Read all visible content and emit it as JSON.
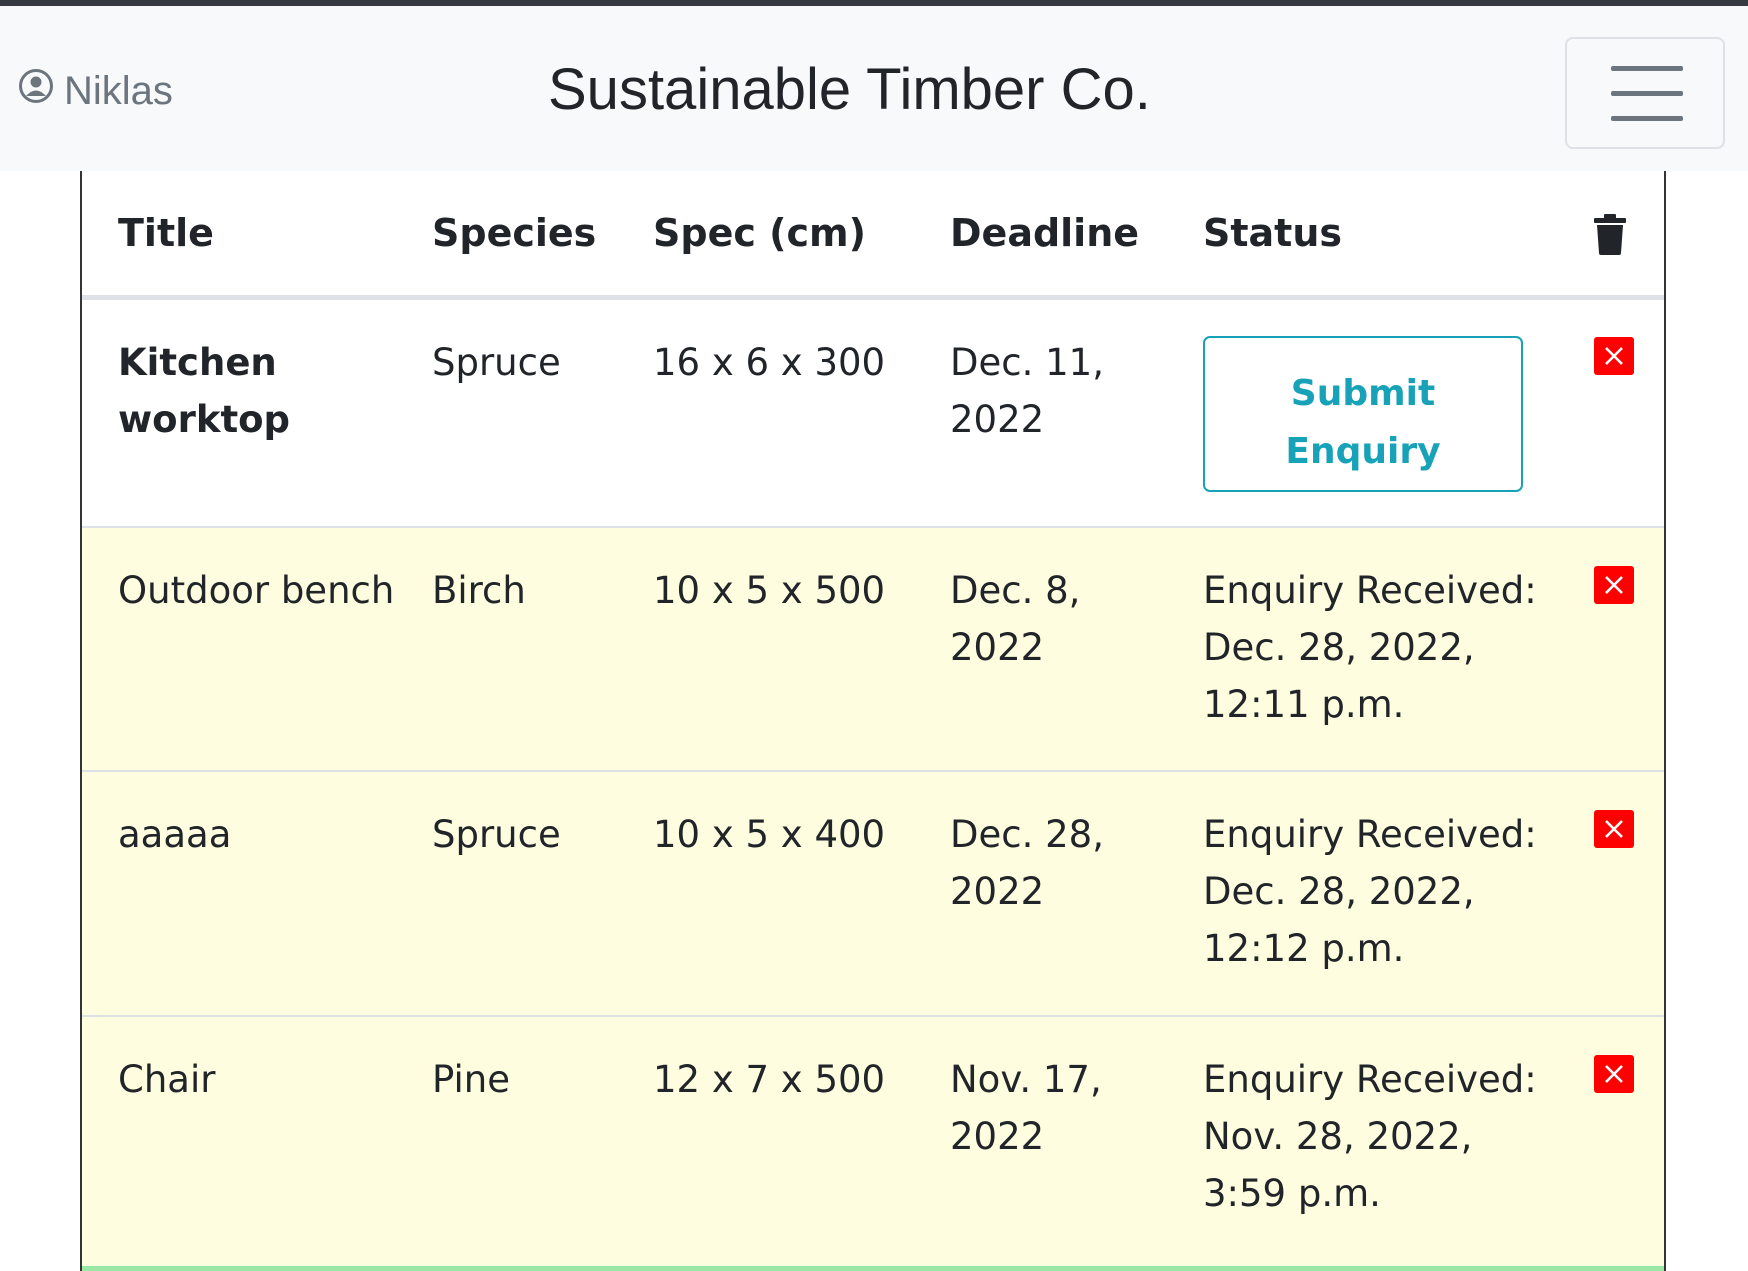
{
  "navbar": {
    "user_name": "Niklas",
    "brand": "Sustainable Timber Co."
  },
  "table": {
    "headers": {
      "title": "Title",
      "species": "Species",
      "spec": "Spec (cm)",
      "deadline": "Deadline",
      "status": "Status"
    },
    "rows": [
      {
        "title": "Kitchen worktop",
        "species": "Spruce",
        "spec": "16 x 6 x 300",
        "deadline": "Dec. 11, 2022",
        "status": "",
        "action_label": "Submit Enquiry"
      },
      {
        "title": "Outdoor bench",
        "species": "Birch",
        "spec": "10 x 5 x 500",
        "deadline": "Dec. 8, 2022",
        "status": "Enquiry Received: Dec. 28, 2022, 12:11 p.m."
      },
      {
        "title": "aaaaa",
        "species": "Spruce",
        "spec": "10 x 5 x 400",
        "deadline": "Dec. 28, 2022",
        "status": "Enquiry Received: Dec. 28, 2022, 12:12 p.m."
      },
      {
        "title": "Chair",
        "species": "Pine",
        "spec": "12 x 7 x 500",
        "deadline": "Nov. 17, 2022",
        "status": "Enquiry Received: Nov. 28, 2022, 3:59 p.m."
      }
    ]
  },
  "colors": {
    "accent": "#17a2b8",
    "delete": "#ff0000",
    "highlight_row": "#fefde0"
  },
  "icons": {
    "user": "user-circle-icon",
    "menu": "hamburger-menu-icon",
    "trash": "trash-icon",
    "delete": "close-icon"
  }
}
